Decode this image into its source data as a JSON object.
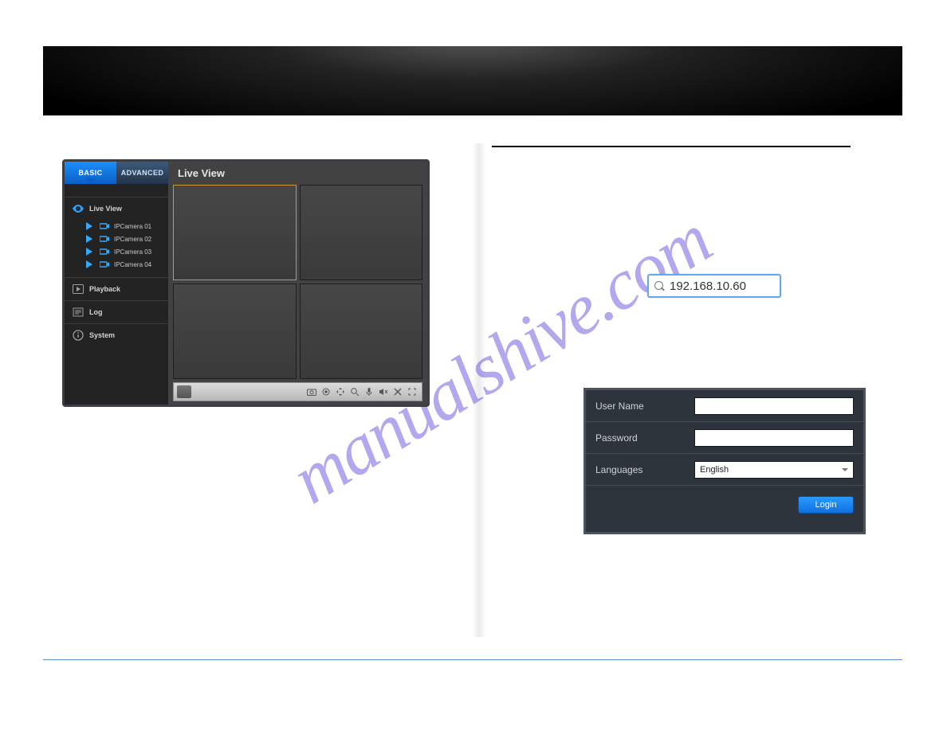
{
  "watermark": "manualshive.com",
  "nvr": {
    "tabs": {
      "basic": "BASIC",
      "advanced": "ADVANCED"
    },
    "title": "Live View",
    "cameras": [
      {
        "label": "IPCamera 01"
      },
      {
        "label": "IPCamera 02"
      },
      {
        "label": "IPCamera 03"
      },
      {
        "label": "IPCamera 04"
      }
    ],
    "menu": {
      "live_view": "Live View",
      "playback": "Playback",
      "log": "Log",
      "system": "System"
    }
  },
  "urlbar": {
    "value": "192.168.10.60"
  },
  "login": {
    "username_label": "User Name",
    "password_label": "Password",
    "language_label": "Languages",
    "language_value": "English",
    "button": "Login"
  }
}
